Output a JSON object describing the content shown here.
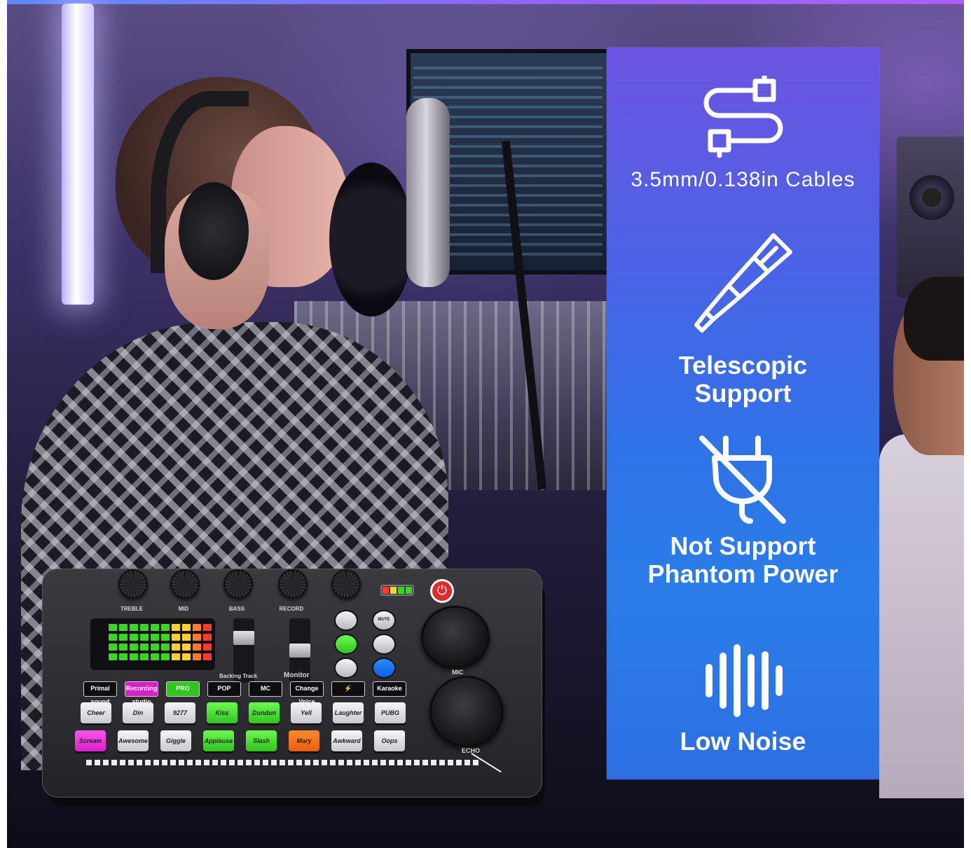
{
  "features": [
    {
      "icon": "cable-icon",
      "label": "3.5mm/0.138in Cables"
    },
    {
      "icon": "telescopic-icon",
      "label": "Telescopic\nSupport"
    },
    {
      "icon": "no-phantom-power-icon",
      "label": "Not Support\nPhantom Power"
    },
    {
      "icon": "sound-wave-icon",
      "label": "Low Noise"
    }
  ],
  "device": {
    "knobs": [
      "TREBLE",
      "MID",
      "BASS",
      "RECORD"
    ],
    "faders": [
      "Backing Track",
      "Monitor"
    ],
    "big_knobs": [
      "MIC",
      "ECHO"
    ],
    "round_buttons_left": [
      "",
      "",
      ""
    ],
    "round_buttons_right": [
      "MUTE",
      "",
      ""
    ],
    "mode_buttons": [
      "Primal sound",
      "Recording studio",
      "PRO",
      "POP",
      "MC",
      "Change Voice",
      "⚡",
      "Karaoke"
    ],
    "pad_row1": [
      "Cheer",
      "Din",
      "9277",
      "Kiss",
      "Dundun",
      "Yell",
      "Laughter",
      "PUBG"
    ],
    "pad_row2": [
      "Scream",
      "Awesome",
      "Giggle",
      "Applause",
      "Slash",
      "Mary",
      "Awkward",
      "Oops"
    ]
  },
  "colors": {
    "panel_top": "#6c55e0",
    "panel_bottom": "#2d6fe3",
    "pad_green": "#3bd427",
    "pad_magenta": "#e52ad6",
    "pad_orange": "#f26a12",
    "power_red": "#e32a2a"
  }
}
